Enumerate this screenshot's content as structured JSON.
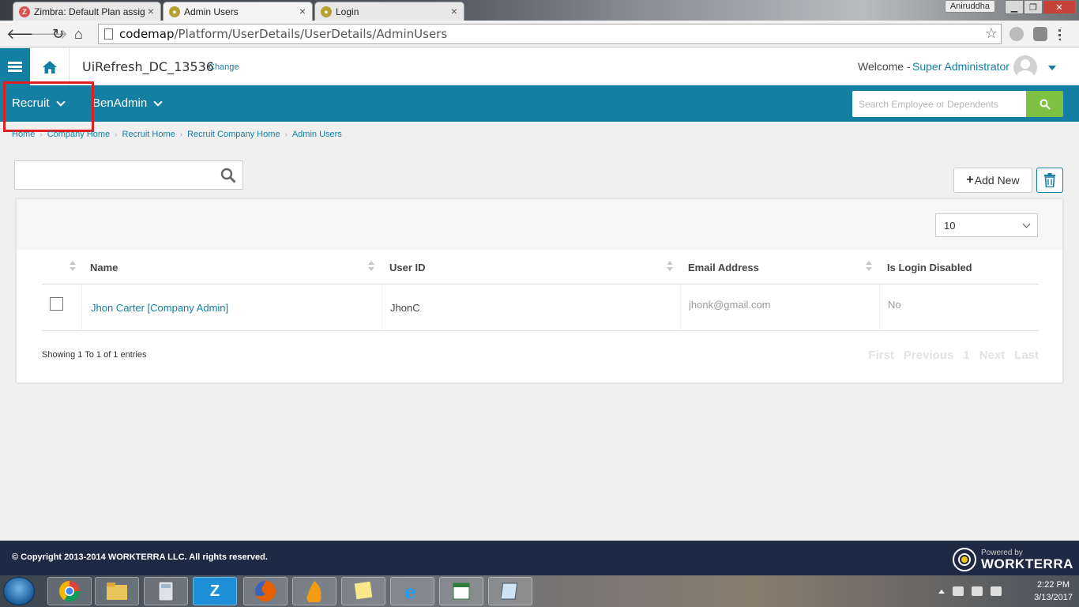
{
  "browser": {
    "tabs": [
      {
        "title": "Zimbra: Default Plan assig",
        "favicon": "zimbra-icon",
        "color": "#d9534f"
      },
      {
        "title": "Admin Users",
        "favicon": "workterra-icon",
        "color": "#b8a030"
      },
      {
        "title": "Login",
        "favicon": "workterra-icon",
        "color": "#b8a030"
      }
    ],
    "user_chip": "Aniruddha",
    "url_host": "codemap",
    "url_path": "/Platform/UserDetails/UserDetails/AdminUsers"
  },
  "header": {
    "company": "UiRefresh_DC_13536",
    "change_label": "Change",
    "welcome_label": "Welcome -",
    "user_name": "Super Administrator"
  },
  "modules": {
    "items": [
      {
        "label": "Recruit"
      },
      {
        "label": "BenAdmin"
      }
    ],
    "search_placeholder": "Search Employee or Dependents"
  },
  "breadcrumb": [
    "Home",
    "Company Home",
    "Recruit Home",
    "Recruit Company Home",
    "Admin Users"
  ],
  "toolbar": {
    "search_value": "",
    "add_new_label": "Add New"
  },
  "table": {
    "page_size": "10",
    "columns": [
      "Name",
      "User ID",
      "Email Address",
      "Is Login Disabled"
    ],
    "rows": [
      {
        "name": "Jhon Carter [Company Admin]",
        "user_id": "JhonC",
        "email": "jhonk@gmail.com",
        "login_disabled": "No"
      }
    ],
    "showing": "Showing 1 To 1 of 1 entries",
    "pager": [
      "First",
      "Previous",
      "1",
      "Next",
      "Last"
    ]
  },
  "footer": {
    "copyright": "© Copyright 2013-2014 WORKTERRA LLC. All rights reserved.",
    "powered_by": "Powered by",
    "brand": "WORKTERRA"
  },
  "taskbar": {
    "time": "2:22 PM",
    "date": "3/13/2017"
  },
  "colors": {
    "primary": "#137fa3",
    "search_button": "#7dc142",
    "footer": "#1e2a44",
    "highlight": "#e02020"
  }
}
